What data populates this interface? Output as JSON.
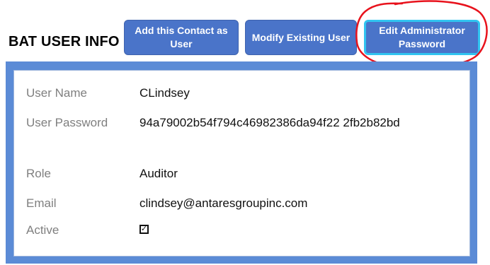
{
  "section_title": "BAT USER INFO",
  "buttons": {
    "add_contact": "Add this Contact as User",
    "modify_existing": "Modify Existing User",
    "edit_admin_password": "Edit Administrator Password"
  },
  "fields": {
    "user_name": {
      "label": "User Name",
      "value": "CLindsey"
    },
    "user_password": {
      "label": "User Password",
      "value": "94a79002b54f794c46982386da94f22 2fb2b82bd"
    },
    "role": {
      "label": "Role",
      "value": "Auditor"
    },
    "email": {
      "label": "Email",
      "value": "clindsey@antaresgroupinc.com"
    },
    "active": {
      "label": "Active",
      "checked": true,
      "check_glyph": "✓"
    }
  },
  "colors": {
    "button_bg": "#4a74c9",
    "panel_frame": "#5b8bd6",
    "highlight_border": "#31c4f0",
    "annotation": "#e8121c"
  }
}
